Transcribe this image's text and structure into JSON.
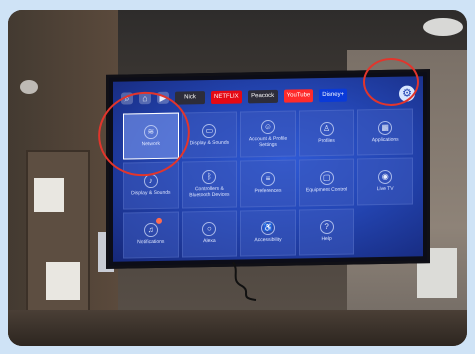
{
  "screen": {
    "apps": [
      "Nick",
      "NETFLIX",
      "Peacock",
      "YouTube",
      "Disney+"
    ],
    "tiles": [
      {
        "label": "Network",
        "icon": "wifi-icon"
      },
      {
        "label": "Display & Sounds",
        "icon": "display-icon"
      },
      {
        "label": "Account & Profile Settings",
        "icon": "profile-icon"
      },
      {
        "label": "Profiles",
        "icon": "user-icon"
      },
      {
        "label": "Applications",
        "icon": "apps-icon"
      },
      {
        "label": "Display & Sounds",
        "icon": "sound-icon"
      },
      {
        "label": "Controllers & Bluetooth Devices",
        "icon": "bluetooth-icon"
      },
      {
        "label": "Preferences",
        "icon": "sliders-icon"
      },
      {
        "label": "Equipment Control",
        "icon": "monitor-icon"
      },
      {
        "label": "Live TV",
        "icon": "antenna-icon"
      },
      {
        "label": "Notifications",
        "icon": "bell-icon"
      },
      {
        "label": "Alexa",
        "icon": "alexa-icon"
      },
      {
        "label": "Accessibility",
        "icon": "accessibility-icon"
      },
      {
        "label": "Help",
        "icon": "help-icon"
      }
    ]
  },
  "annotations": {
    "circle_color": "#e2352c"
  }
}
